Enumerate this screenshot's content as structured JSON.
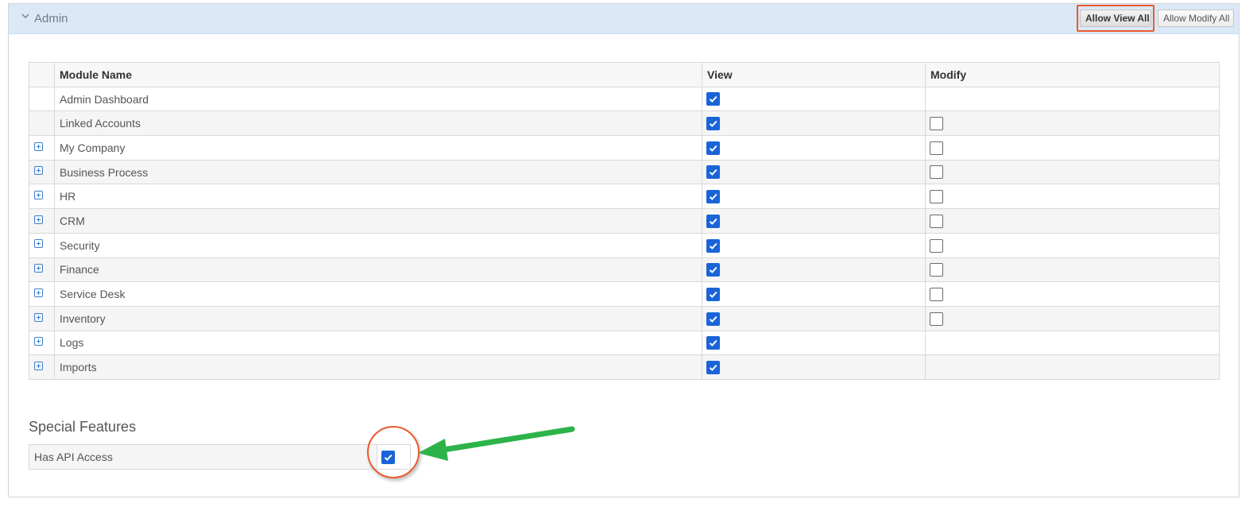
{
  "section": {
    "title": "Admin",
    "buttons": {
      "allow_view_all": "Allow View All",
      "allow_modify_all": "Allow Modify All"
    }
  },
  "table": {
    "headers": [
      "",
      "Module Name",
      "View",
      "Modify"
    ],
    "rows": [
      {
        "name": "Admin Dashboard",
        "expandable": false,
        "view": true,
        "modify": null
      },
      {
        "name": "Linked Accounts",
        "expandable": false,
        "view": true,
        "modify": false
      },
      {
        "name": "My Company",
        "expandable": true,
        "view": true,
        "modify": false
      },
      {
        "name": "Business Process",
        "expandable": true,
        "view": true,
        "modify": false
      },
      {
        "name": "HR",
        "expandable": true,
        "view": true,
        "modify": false
      },
      {
        "name": "CRM",
        "expandable": true,
        "view": true,
        "modify": false
      },
      {
        "name": "Security",
        "expandable": true,
        "view": true,
        "modify": false
      },
      {
        "name": "Finance",
        "expandable": true,
        "view": true,
        "modify": false
      },
      {
        "name": "Service Desk",
        "expandable": true,
        "view": true,
        "modify": false
      },
      {
        "name": "Inventory",
        "expandable": true,
        "view": true,
        "modify": false
      },
      {
        "name": "Logs",
        "expandable": true,
        "view": true,
        "modify": null
      },
      {
        "name": "Imports",
        "expandable": true,
        "view": true,
        "modify": null
      }
    ]
  },
  "special_features": {
    "title": "Special Features",
    "items": [
      {
        "label": "Has API Access",
        "checked": true
      }
    ]
  },
  "colors": {
    "header_bg": "#dbe8f7",
    "checkbox_checked": "#1a64d8",
    "highlight": "#e95a2b",
    "arrow": "#2db34a"
  }
}
